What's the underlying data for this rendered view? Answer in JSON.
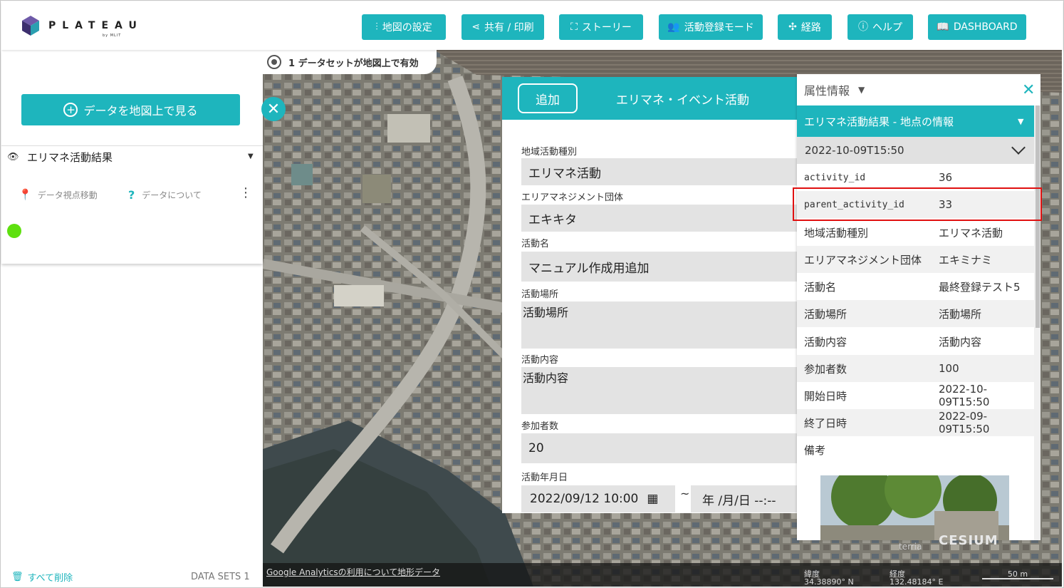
{
  "header": {
    "logo_text": "PLATEAU",
    "logo_sub": "by MLIT",
    "buttons": [
      {
        "label": "地図の設定",
        "icon": "sliders-icon"
      },
      {
        "label": "共有 / 印刷",
        "icon": "share-icon"
      },
      {
        "label": "ストーリー",
        "icon": "story-icon"
      },
      {
        "label": "活動登録モード",
        "icon": "users-icon"
      },
      {
        "label": "経路",
        "icon": "route-icon"
      },
      {
        "label": "ヘルプ",
        "icon": "help-icon"
      },
      {
        "label": "DASHBOARD",
        "icon": "book-icon"
      }
    ]
  },
  "left_panel": {
    "view_data_button": "データを地図上で見る",
    "layer": {
      "title": "エリマネ活動結果",
      "action_move": "データ視点移動",
      "action_about": "データについて",
      "legend_color": "#5ee00f"
    },
    "delete_all": "すべて削除",
    "datasets_count": "DATA SETS 1"
  },
  "map": {
    "datasets_pill": "1 データセットが地図上で有効",
    "google_analytics_link": "Google Analyticsの利用について",
    "terrain_link": "地形データ",
    "lat_label": "緯度",
    "lat_value": "34.38890° N",
    "lon_label": "経度",
    "lon_value": "132.48184° E",
    "scale": "50 m",
    "cesium": "CESIUM",
    "terria": "terria"
  },
  "form": {
    "add_button": "追加",
    "title": "エリマネ・イベント活動",
    "fields": {
      "activity_type": {
        "label": "地域活動種別",
        "value": "エリマネ活動"
      },
      "org": {
        "label": "エリアマネジメント団体",
        "value": "エキキタ"
      },
      "name": {
        "label": "活動名",
        "value": "マニュアル作成用追加"
      },
      "place": {
        "label": "活動場所",
        "value": "活動場所"
      },
      "content": {
        "label": "活動内容",
        "value": "活動内容"
      },
      "participants": {
        "label": "参加者数",
        "value": "20"
      },
      "date": {
        "label": "活動年月日",
        "start": "2022/09/12 10:00",
        "tilde": "~",
        "end": "年 /月/日 --:--"
      }
    }
  },
  "attributes": {
    "header": "属性情報",
    "subheader": "エリマネ活動結果 - 地点の情報",
    "selected_date": "2022-10-09T15:50",
    "rows": [
      {
        "key": "activity_id",
        "value": "36"
      },
      {
        "key": "parent_activity_id",
        "value": "33"
      },
      {
        "key": "地域活動種別",
        "value": "エリマネ活動"
      },
      {
        "key": "エリアマネジメント団体",
        "value": "エキミナミ"
      },
      {
        "key": "活動名",
        "value": "最終登録テスト5"
      },
      {
        "key": "活動場所",
        "value": "活動場所"
      },
      {
        "key": "活動内容",
        "value": "活動内容"
      },
      {
        "key": "参加者数",
        "value": "100"
      },
      {
        "key": "開始日時",
        "value": "2022-10-09T15:50"
      },
      {
        "key": "終了日時",
        "value": "2022-09-09T15:50"
      },
      {
        "key": "備考",
        "value": ""
      }
    ]
  },
  "colors": {
    "accent": "#1eb5bd",
    "highlight": "#e01010"
  }
}
